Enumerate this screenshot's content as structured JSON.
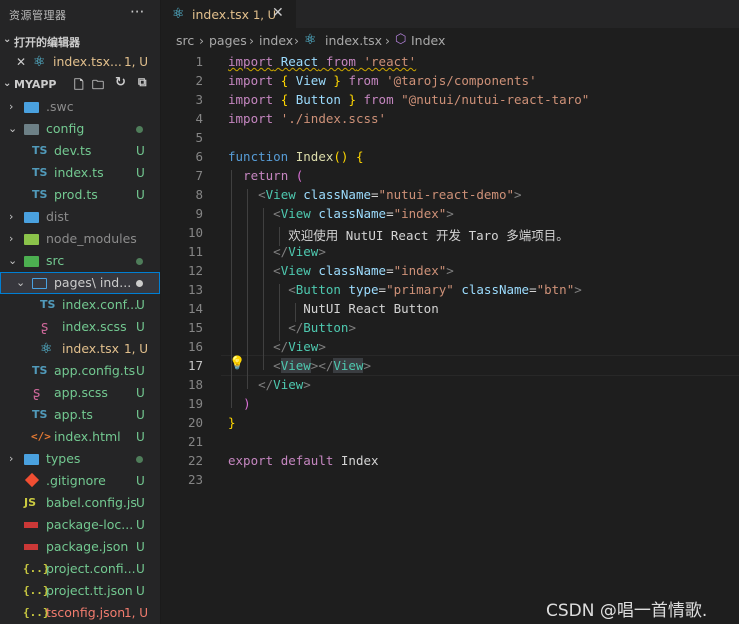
{
  "sidebar": {
    "title": "资源管理器",
    "more": "···",
    "open_editors": {
      "label": "打开的编辑器",
      "file": "index.tsx...",
      "badge": "1, U"
    },
    "project": {
      "label": "MYAPP"
    },
    "tree": [
      {
        "name": ".swc",
        "badge": "",
        "kind": "folder"
      },
      {
        "name": "config",
        "badge": "dot",
        "kind": "folder-open"
      },
      {
        "name": "dev.ts",
        "badge": "U",
        "kind": "ts"
      },
      {
        "name": "index.ts",
        "badge": "U",
        "kind": "ts"
      },
      {
        "name": "prod.ts",
        "badge": "U",
        "kind": "ts"
      },
      {
        "name": "dist",
        "badge": "",
        "kind": "folder"
      },
      {
        "name": "node_modules",
        "badge": "",
        "kind": "folder"
      },
      {
        "name": "src",
        "badge": "dot",
        "kind": "folder-open"
      },
      {
        "name": "pages\\ ind...",
        "badge": "dot",
        "kind": "folder-open"
      },
      {
        "name": "index.conf...",
        "badge": "U",
        "kind": "ts"
      },
      {
        "name": "index.scss",
        "badge": "U",
        "kind": "sass"
      },
      {
        "name": "index.tsx",
        "badge": "1, U",
        "kind": "react"
      },
      {
        "name": "app.config.ts",
        "badge": "U",
        "kind": "ts"
      },
      {
        "name": "app.scss",
        "badge": "U",
        "kind": "sass"
      },
      {
        "name": "app.ts",
        "badge": "U",
        "kind": "ts"
      },
      {
        "name": "index.html",
        "badge": "U",
        "kind": "html"
      },
      {
        "name": "types",
        "badge": "dot",
        "kind": "folder"
      },
      {
        "name": ".gitignore",
        "badge": "U",
        "kind": "git"
      },
      {
        "name": "babel.config.js",
        "badge": "U",
        "kind": "js"
      },
      {
        "name": "package-loc...",
        "badge": "U",
        "kind": "npm"
      },
      {
        "name": "package.json",
        "badge": "U",
        "kind": "npm"
      },
      {
        "name": "project.confi...",
        "badge": "U",
        "kind": "json"
      },
      {
        "name": "project.tt.json",
        "badge": "U",
        "kind": "json"
      },
      {
        "name": "tsconfig.json",
        "badge": "1, U",
        "kind": "json"
      }
    ]
  },
  "tab": {
    "label": "index.tsx",
    "badge": "1, U",
    "close": "✕"
  },
  "breadcrumb": [
    "src",
    "pages",
    "index",
    "index.tsx",
    "Index"
  ],
  "code": {
    "line_numbers": [
      "1",
      "2",
      "3",
      "4",
      "5",
      "6",
      "7",
      "8",
      "9",
      "10",
      "11",
      "12",
      "13",
      "14",
      "15",
      "16",
      "17",
      "18",
      "19",
      "20",
      "21",
      "22",
      "23"
    ],
    "active_line": "17",
    "tokens": {
      "import": "import",
      "from": "from",
      "react_id": "React",
      "react_str": "'react'",
      "view": "View",
      "button": "Button",
      "taro_str": "'@tarojs/components'",
      "nutui_str": "\"@nutui/nutui-react-taro\"",
      "scss_str": "'./index.scss'",
      "function": "function",
      "index_fn": "Index",
      "return": "return",
      "classname": "className",
      "type": "type",
      "demo_str": "\"nutui-react-demo\"",
      "index_str": "\"index\"",
      "primary_str": "\"primary\"",
      "btn_str": "\"btn\"",
      "welcome": "欢迎使用 NutUI React 开发 Taro 多端项目。",
      "btn_text": "NutUI React Button",
      "export": "export",
      "default": "default",
      "index_id": "Index"
    }
  },
  "watermark": "CSDN @唱一首情歌."
}
